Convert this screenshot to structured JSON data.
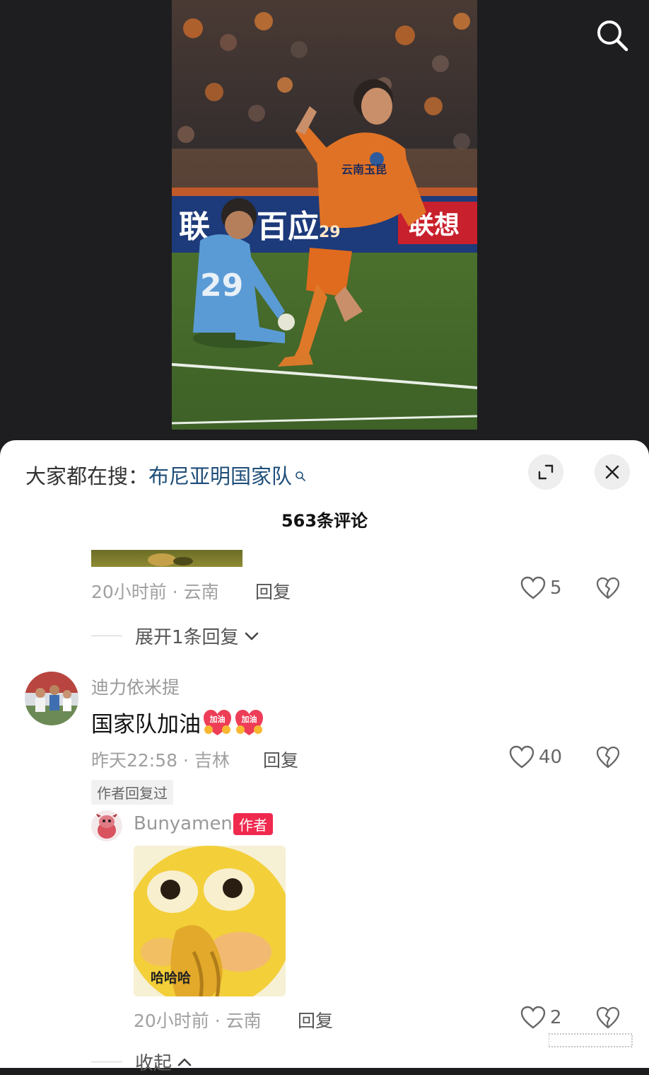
{
  "header": {
    "search_icon": "search-icon"
  },
  "sheet": {
    "hot_search_prefix": "大家都在搜：",
    "hot_search_term": "布尼亚明国家队",
    "expand_icon": "expand-icon",
    "close_icon": "close-icon",
    "comment_count": "563条评论"
  },
  "comments": [
    {
      "meta": "20小时前 · 云南",
      "reply_label": "回复",
      "likes": "5",
      "expand_replies": "展开1条回复"
    },
    {
      "username": "迪力依米提",
      "text": "国家队加油",
      "emojis": [
        "加油",
        "加油"
      ],
      "meta": "昨天22:58 · 吉林",
      "reply_label": "回复",
      "likes": "40",
      "author_replied": "作者回复过",
      "replies": [
        {
          "username": "Bunyamen",
          "author_tag": "作者",
          "sticker_caption": "哈哈哈",
          "meta": "20小时前 · 云南",
          "reply_label": "回复",
          "likes": "2"
        }
      ],
      "collapse_label": "收起"
    }
  ],
  "colors": {
    "link": "#1f4e79",
    "author_tag": "#f0294e",
    "jersey_orange": "#e06a1e",
    "keeper_blue": "#5b9bd5"
  }
}
